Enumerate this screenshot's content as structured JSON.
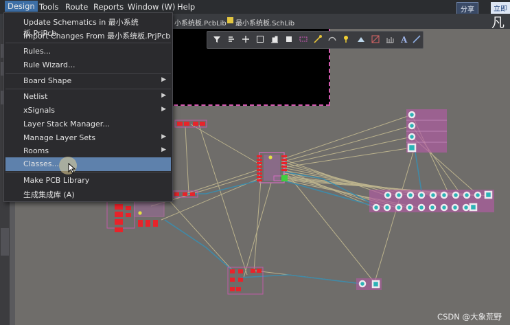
{
  "menubar": {
    "items": [
      {
        "label": "Design"
      },
      {
        "label": "Tools"
      },
      {
        "label": "Route"
      },
      {
        "label": "Reports"
      },
      {
        "label": "Window (W)"
      },
      {
        "label": "Help"
      }
    ],
    "share_label": "分享",
    "login_label": "立即"
  },
  "tabs": {
    "pcblib": "小系统板.PcbLib",
    "schlib": "最小系统板.SchLib",
    "corner_char": "凡"
  },
  "design_menu": {
    "items": [
      {
        "label": "Update Schematics in 最小系统板.PrjPcb",
        "submenu": false
      },
      {
        "label": "Import Changes From 最小系统板.PrjPcb",
        "submenu": false
      },
      {
        "label": "Rules...",
        "submenu": false
      },
      {
        "label": "Rule Wizard...",
        "submenu": false
      },
      {
        "label": "Board Shape",
        "submenu": true
      },
      {
        "label": "Netlist",
        "submenu": true
      },
      {
        "label": "xSignals",
        "submenu": true
      },
      {
        "label": "Layer Stack Manager...",
        "submenu": false
      },
      {
        "label": "Manage Layer Sets",
        "submenu": true
      },
      {
        "label": "Rooms",
        "submenu": true
      },
      {
        "label": "Classes...",
        "submenu": false,
        "highlighted": true
      },
      {
        "label": "Make PCB Library",
        "submenu": false
      },
      {
        "label": "生成集成库 (A)",
        "submenu": false
      }
    ]
  },
  "pcb_toolbar": {
    "icons": [
      "filter-icon",
      "route-icon",
      "cross-icon",
      "select-rect-icon",
      "align-icon",
      "component-icon",
      "interactive-route-icon",
      "diff-pair-icon",
      "probe-icon",
      "fill-icon",
      "polygon-icon",
      "keepout-icon",
      "dimension-icon",
      "text-icon",
      "line-icon"
    ]
  },
  "watermark": "CSDN @大象荒野",
  "colors": {
    "menubar_bg": "#2b2d30",
    "menu_bg": "#2b2b2e",
    "highlight": "#5e81ac",
    "board_bg": "#6f6d6a",
    "pad_red": "#e8232a",
    "silk_magenta": "#c25aa8",
    "ratsnest": "#c9bf93",
    "track_blue": "#3f8aa8",
    "via_teal": "#2bb3b6"
  }
}
